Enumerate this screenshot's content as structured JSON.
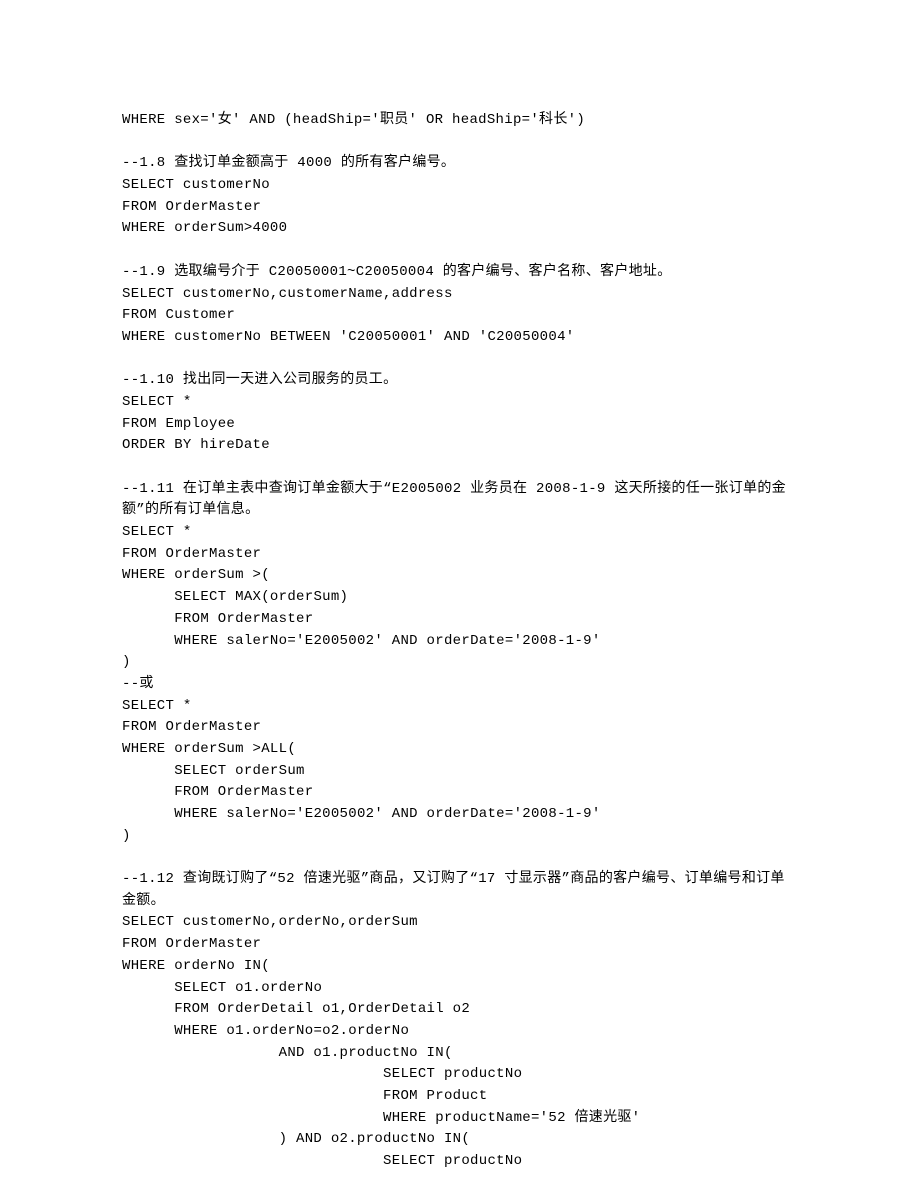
{
  "lines": [
    {
      "t": "WHERE sex='女' AND (headShip='职员' OR headShip='科长')",
      "cls": "mono"
    },
    {
      "t": "",
      "cls": "mono"
    },
    {
      "t": "--1.8 查找订单金额高于 4000 的所有客户编号。",
      "cls": "mono"
    },
    {
      "t": "SELECT customerNo",
      "cls": "mono"
    },
    {
      "t": "FROM OrderMaster",
      "cls": "mono"
    },
    {
      "t": "WHERE orderSum>4000",
      "cls": "mono"
    },
    {
      "t": "",
      "cls": "mono"
    },
    {
      "t": "--1.9 选取编号介于 C20050001~C20050004 的客户编号、客户名称、客户地址。",
      "cls": "mono"
    },
    {
      "t": "SELECT customerNo,customerName,address",
      "cls": "mono"
    },
    {
      "t": "FROM Customer",
      "cls": "mono"
    },
    {
      "t": "WHERE customerNo BETWEEN 'C20050001' AND 'C20050004'",
      "cls": "mono"
    },
    {
      "t": "",
      "cls": "mono"
    },
    {
      "t": "--1.10 找出同一天进入公司服务的员工。",
      "cls": "mono"
    },
    {
      "t": "SELECT *",
      "cls": "mono"
    },
    {
      "t": "FROM Employee",
      "cls": "mono"
    },
    {
      "t": "ORDER BY hireDate",
      "cls": "mono"
    },
    {
      "t": "",
      "cls": "mono"
    },
    {
      "t": "--1.11 在订单主表中查询订单金额大于“E2005002 业务员在 2008-1-9 这天所接的任一张订单的金额”的所有订单信息。",
      "cls": "mono"
    },
    {
      "t": "SELECT *",
      "cls": "mono"
    },
    {
      "t": "FROM OrderMaster",
      "cls": "mono"
    },
    {
      "t": "WHERE orderSum >(",
      "cls": "mono"
    },
    {
      "t": "      SELECT MAX(orderSum)",
      "cls": "mono"
    },
    {
      "t": "      FROM OrderMaster",
      "cls": "mono"
    },
    {
      "t": "      WHERE salerNo='E2005002' AND orderDate='2008-1-9'",
      "cls": "mono"
    },
    {
      "t": ")",
      "cls": "mono"
    },
    {
      "t": "--或",
      "cls": "mono"
    },
    {
      "t": "SELECT *",
      "cls": "mono"
    },
    {
      "t": "FROM OrderMaster",
      "cls": "mono"
    },
    {
      "t": "WHERE orderSum >ALL(",
      "cls": "mono"
    },
    {
      "t": "      SELECT orderSum",
      "cls": "mono"
    },
    {
      "t": "      FROM OrderMaster",
      "cls": "mono"
    },
    {
      "t": "      WHERE salerNo='E2005002' AND orderDate='2008-1-9'",
      "cls": "mono"
    },
    {
      "t": ")",
      "cls": "mono"
    },
    {
      "t": "",
      "cls": "mono"
    },
    {
      "t": "--1.12 查询既订购了“52 倍速光驱”商品，又订购了“17 寸显示器”商品的客户编号、订单编号和订单金额。",
      "cls": "mono"
    },
    {
      "t": "SELECT customerNo,orderNo,orderSum",
      "cls": "mono"
    },
    {
      "t": "FROM OrderMaster",
      "cls": "mono"
    },
    {
      "t": "WHERE orderNo IN(",
      "cls": "mono"
    },
    {
      "t": "      SELECT o1.orderNo",
      "cls": "mono"
    },
    {
      "t": "      FROM OrderDetail o1,OrderDetail o2",
      "cls": "mono"
    },
    {
      "t": "      WHERE o1.orderNo=o2.orderNo",
      "cls": "mono"
    },
    {
      "t": "                  AND o1.productNo IN(",
      "cls": "mono"
    },
    {
      "t": "                              SELECT productNo",
      "cls": "mono"
    },
    {
      "t": "                              FROM Product",
      "cls": "mono"
    },
    {
      "t": "                              WHERE productName='52 倍速光驱'",
      "cls": "mono"
    },
    {
      "t": "                  ) AND o2.productNo IN(",
      "cls": "mono"
    },
    {
      "t": "                              SELECT productNo",
      "cls": "mono"
    }
  ]
}
